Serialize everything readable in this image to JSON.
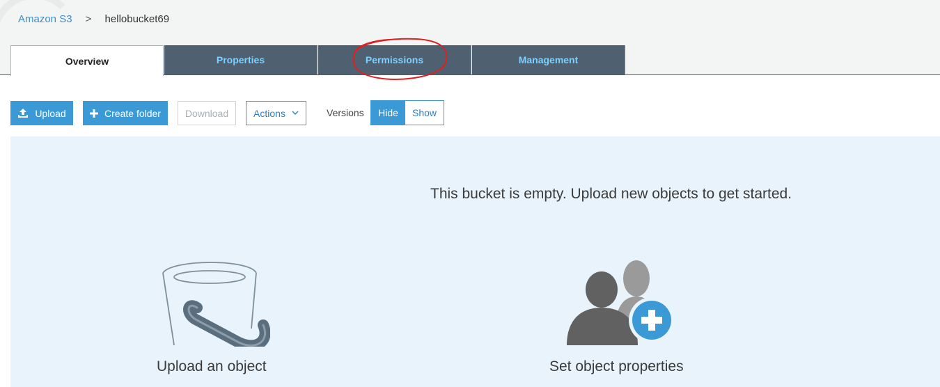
{
  "breadcrumb": {
    "root": "Amazon S3",
    "separator": ">",
    "current": "hellobucket69"
  },
  "tabs": [
    {
      "label": "Overview",
      "active": true
    },
    {
      "label": "Properties",
      "active": false
    },
    {
      "label": "Permissions",
      "active": false
    },
    {
      "label": "Management",
      "active": false
    }
  ],
  "toolbar": {
    "upload_label": "Upload",
    "create_folder_label": "Create folder",
    "download_label": "Download",
    "actions_label": "Actions",
    "versions_label": "Versions",
    "versions_hide": "Hide",
    "versions_show": "Show",
    "versions_selected": "Hide"
  },
  "empty_state": {
    "message": "This bucket is empty. Upload new objects to get started.",
    "cards": [
      {
        "title": "Upload an object",
        "icon": "bucket-icon"
      },
      {
        "title": "Set object properties",
        "icon": "users-add-icon"
      }
    ]
  },
  "colors": {
    "accent": "#3b99d6",
    "tab_inactive_bg": "#4f6070",
    "tab_inactive_text": "#7fd0ff",
    "panel_bg": "#e8f3fb",
    "annotation": "#e02020"
  }
}
